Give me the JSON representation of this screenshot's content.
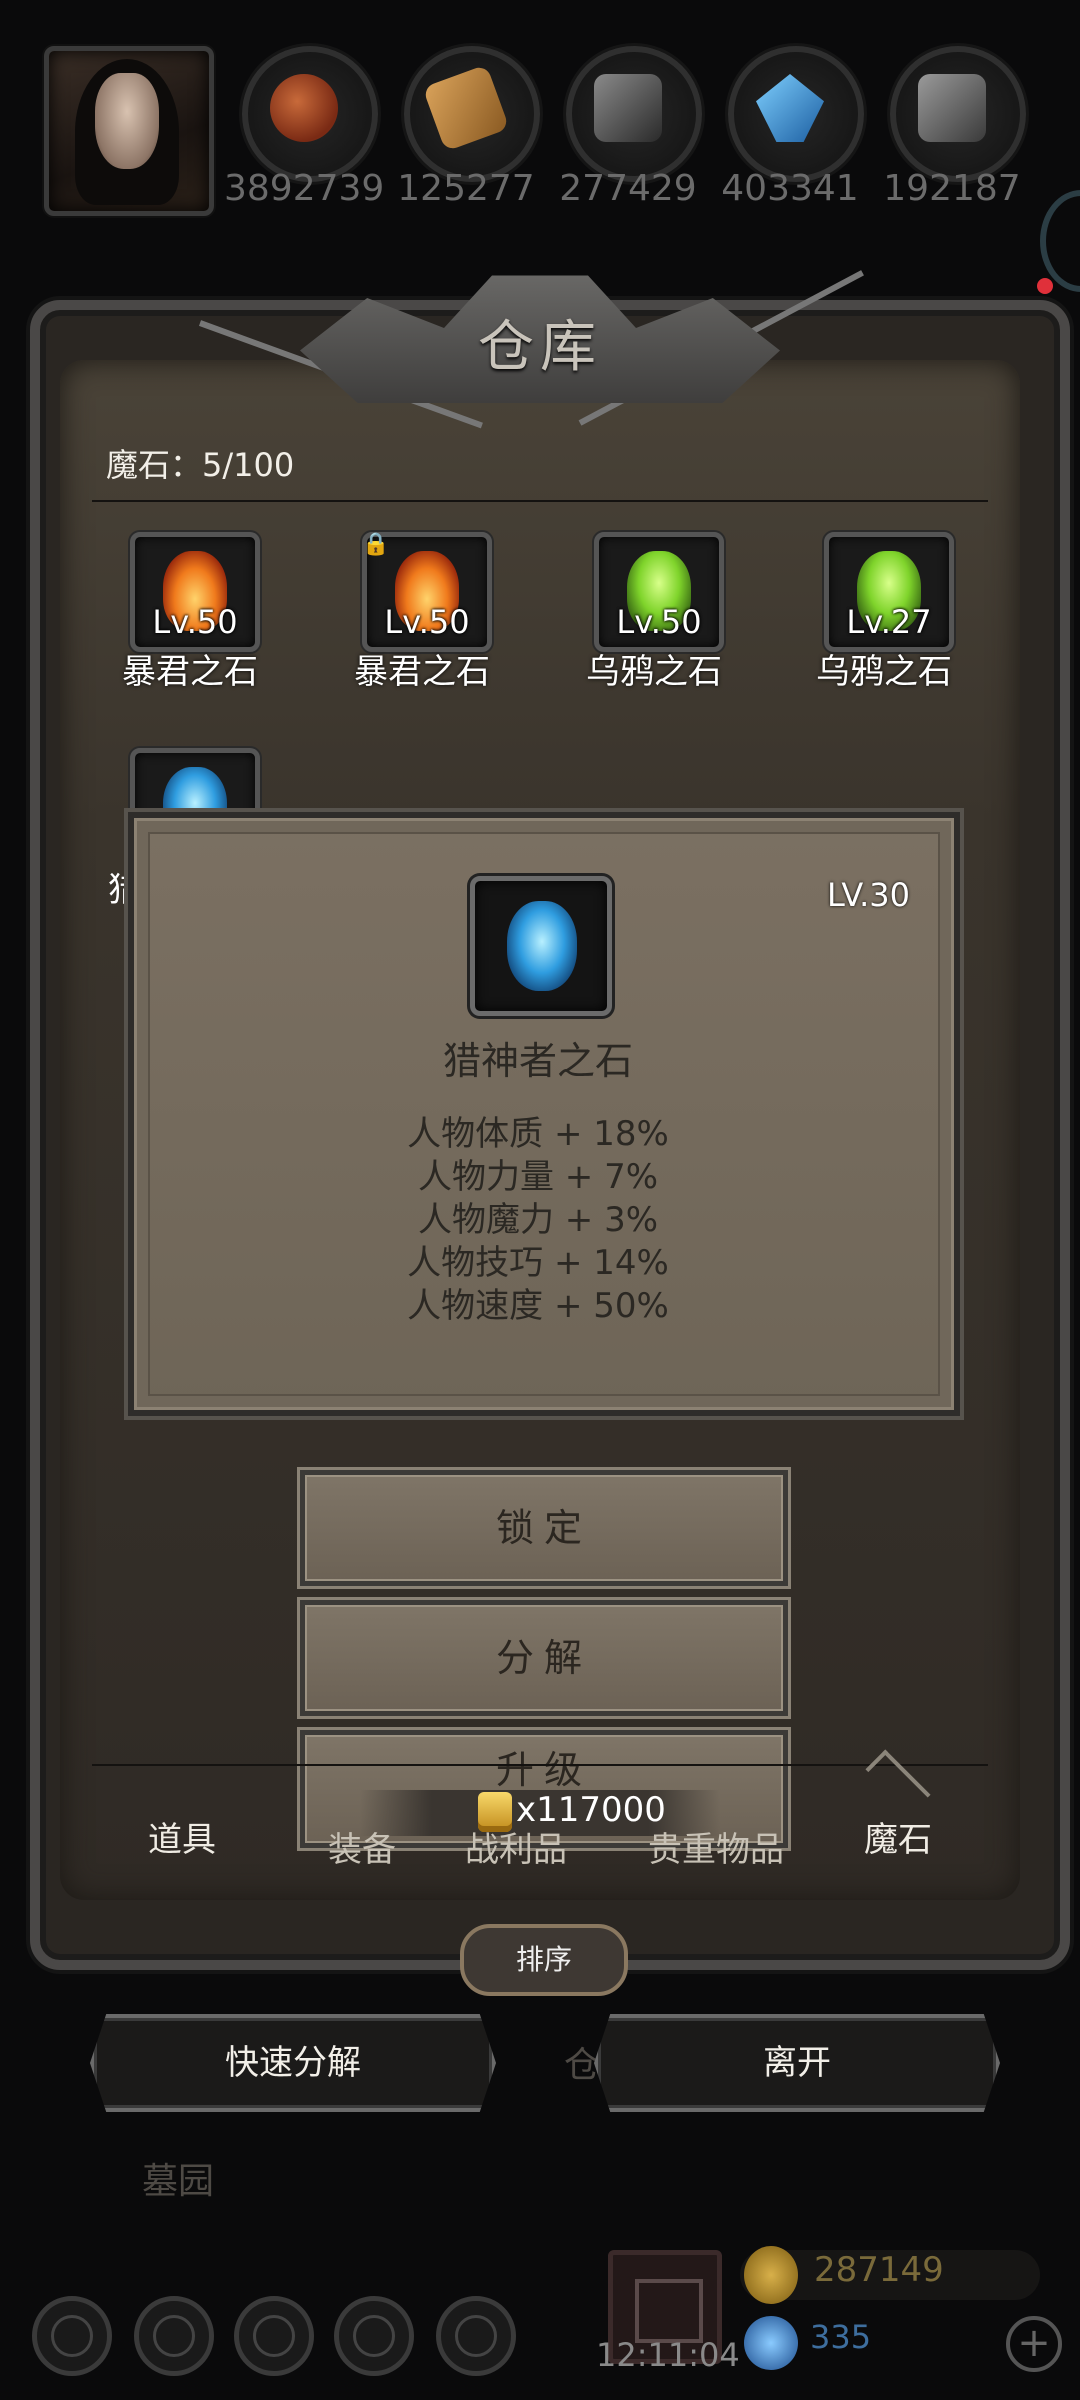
{
  "top": {
    "resources": [
      {
        "icon": "meat-icon",
        "value": "3892739"
      },
      {
        "icon": "wood-icon",
        "value": "125277"
      },
      {
        "icon": "stone-icon",
        "value": "277429"
      },
      {
        "icon": "crystal-icon",
        "value": "403341"
      },
      {
        "icon": "iron-icon",
        "value": "192187"
      }
    ]
  },
  "warehouse": {
    "title": "仓库",
    "capacity": "魔石：5/100",
    "items": [
      {
        "name": "暴君之石",
        "level": "Lv.50",
        "type": "fire",
        "locked": false
      },
      {
        "name": "暴君之石",
        "level": "Lv.50",
        "type": "fire",
        "locked": true
      },
      {
        "name": "乌鸦之石",
        "level": "Lv.50",
        "type": "green",
        "locked": false
      },
      {
        "name": "乌鸦之石",
        "level": "Lv.27",
        "type": "green",
        "locked": false
      },
      {
        "name": "猎",
        "level": "",
        "type": "blue",
        "locked": false
      }
    ],
    "tabs": [
      "道具",
      "装备",
      "战利品",
      "贵重物品",
      "魔石"
    ],
    "active_tab": "魔石",
    "sort_label": "排序",
    "quick_decompose": "快速分解",
    "leave": "离开"
  },
  "detail": {
    "level": "LV.30",
    "name": "猎神者之石",
    "stats": [
      "人物体质 + 18%",
      "人物力量 + 7%",
      "人物魔力 + 3%",
      "人物技巧 + 14%",
      "人物速度 + 50%"
    ],
    "lock_label": "锁定",
    "decompose_label": "分解",
    "upgrade_label": "升级",
    "upgrade_cost": "x117000"
  },
  "background": {
    "cang": "仓",
    "graveyard": "墓园"
  },
  "bottom": {
    "time": "12:11:04",
    "gold": "287149",
    "gems": "335",
    "plus": "+"
  },
  "colors": {
    "panel": "#3a342c",
    "popup": "#7b7062",
    "text_light": "#f2efe8",
    "text_dark": "#2b2823"
  }
}
